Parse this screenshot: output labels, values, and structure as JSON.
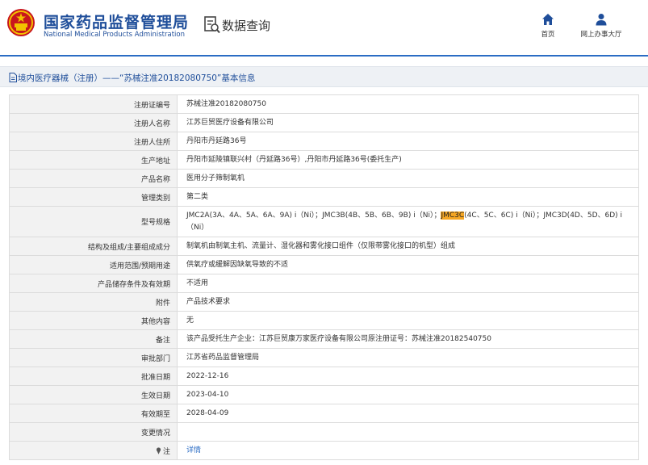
{
  "header": {
    "agency_cn": "国家药品监督管理局",
    "agency_en": "National Medical Products Administration",
    "query_title": "数据查询",
    "nav": {
      "home_label": "首页",
      "hall_label": "网上办事大厅"
    }
  },
  "breadcrumb": {
    "text": "境内医疗器械（注册）——“苏械注准20182080750”基本信息"
  },
  "detail_rows": [
    {
      "label": "注册证编号",
      "value": "苏械注准20182080750"
    },
    {
      "label": "注册人名称",
      "value": "江苏巨贸医疗设备有限公司"
    },
    {
      "label": "注册人住所",
      "value": "丹阳市丹延路36号"
    },
    {
      "label": "生产地址",
      "value": "丹阳市延陵镇联兴村（丹延路36号）,丹阳市丹延路36号(委托生产)"
    },
    {
      "label": "产品名称",
      "value": "医用分子筛制氧机"
    },
    {
      "label": "管理类别",
      "value": "第二类"
    },
    {
      "label": "型号规格",
      "value_before": "JMC2A(3A、4A、5A、6A、9A) i（Ni）；JMC3B(4B、5B、6B、9B) i（Ni）；",
      "value_highlight": "JMC3C",
      "value_after": "(4C、5C、6C) i（Ni）；JMC3D(4D、5D、6D) i（Ni）"
    },
    {
      "label": "结构及组成/主要组成成分",
      "value": "制氧机由制氧主机、流量计、湿化器和雾化接口组件（仅限带雾化接口的机型）组成"
    },
    {
      "label": "适用范围/预期用途",
      "value": "供氧疗或缓解因缺氧导致的不适"
    },
    {
      "label": "产品储存条件及有效期",
      "value": "不适用"
    },
    {
      "label": "附件",
      "value": "产品技术要求"
    },
    {
      "label": "其他内容",
      "value": "无"
    },
    {
      "label": "备注",
      "value": "该产品受托生产企业：江苏巨贸康万家医疗设备有限公司原注册证号：苏械注准20182540750"
    },
    {
      "label": "审批部门",
      "value": "江苏省药品监督管理局"
    },
    {
      "label": "批准日期",
      "value": "2022-12-16"
    },
    {
      "label": "生效日期",
      "value": "2023-04-10"
    },
    {
      "label": "有效期至",
      "value": "2028-04-09"
    },
    {
      "label": "变更情况",
      "value": ""
    },
    {
      "label": "注",
      "value": "详情"
    }
  ],
  "colors": {
    "brand_blue": "#1f4e9a",
    "highlight": "#f5a623",
    "link": "#2b6cc4",
    "emblem_red": "#c8161d",
    "emblem_gold": "#f2c200"
  },
  "icons": {
    "emblem": "national-emblem-icon",
    "query": "search-document-icon",
    "home": "home-icon",
    "hall": "user-icon",
    "crumb": "document-icon",
    "note": "pin-icon"
  }
}
